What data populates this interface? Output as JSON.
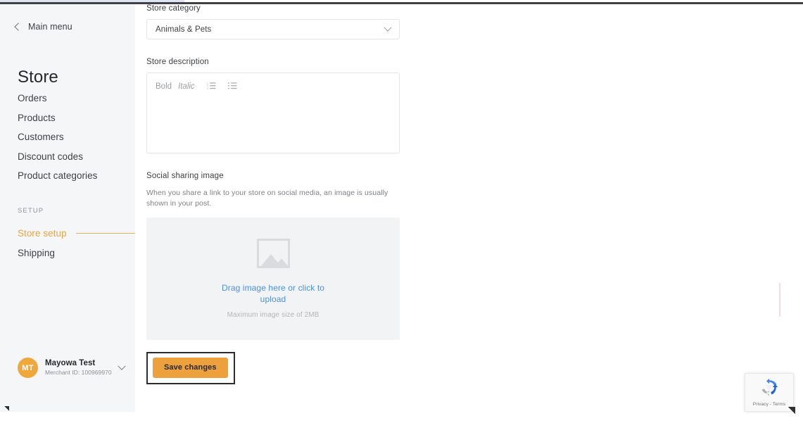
{
  "chrome": {
    "accent_lavender": "#dfe4f5",
    "rule_color": "#3f4145"
  },
  "sidebar": {
    "back_label": "Main menu",
    "title": "Store",
    "nav_items": [
      {
        "label": "Orders"
      },
      {
        "label": "Products"
      },
      {
        "label": "Customers"
      },
      {
        "label": "Discount codes"
      },
      {
        "label": "Product categories"
      }
    ],
    "section_label": "SETUP",
    "setup_items": [
      {
        "label": "Store setup",
        "active": true
      },
      {
        "label": "Shipping",
        "active": false
      }
    ],
    "user": {
      "initials": "MT",
      "name": "Mayowa Test",
      "merchant_id": "Merchant ID: 100969970"
    },
    "active_color": "#eda43b"
  },
  "form": {
    "category": {
      "label": "Store category",
      "value": "Animals & Pets",
      "icon": "chevron-down-icon"
    },
    "description": {
      "label": "Store description",
      "value": "",
      "toolbar": {
        "bold": "Bold",
        "italic": "Italic",
        "ordered_list": "ordered-list-icon",
        "bullet_list": "bullet-list-icon"
      }
    },
    "social": {
      "label": "Social sharing image",
      "help": "When you share a link to your store on social media, an image is usually shown in your post.",
      "dropzone_cta": "Drag image here or click to upload",
      "dropzone_hint": "Maximum image size of 2MB",
      "cta_color": "#4a90e2"
    },
    "save_label": "Save changes",
    "save_color": "#eda13c"
  },
  "recaptcha": {
    "terms": "Privacy - Terms",
    "icon": "recaptcha-icon"
  }
}
